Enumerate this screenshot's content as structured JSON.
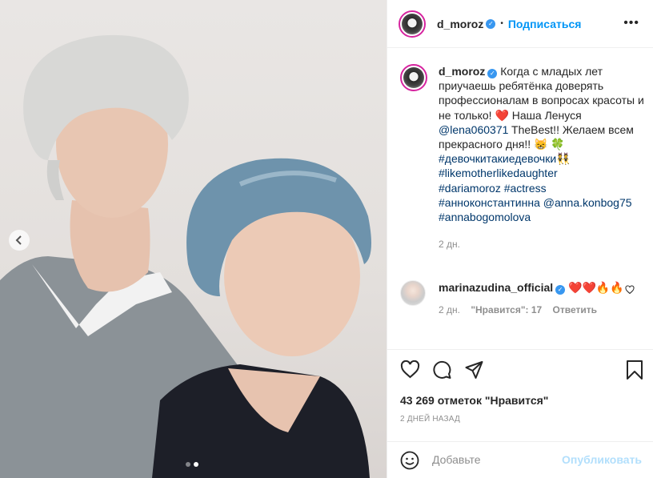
{
  "post": {
    "author": "d_moroz",
    "follow_label": "Подписаться",
    "header_dot": "•",
    "more_label": "•••"
  },
  "caption": {
    "username": "d_moroz",
    "text_1": "Когда с младых лет приучаешь ребятёнка доверять профессионалам в вопросах красоты и не только! ",
    "heart": "❤️",
    "text_2": " Наша Ленуся ",
    "mention_1": "@lena060371",
    "text_3": " TheBest!! Желаем всем прекрасного дня!! ",
    "emoji_1": "😸",
    "emoji_2": "🍀",
    "hashtag_1": "#девочкитакиедевочки",
    "emoji_3": "👯",
    "hashtag_2": "#likemotherlikedaughter",
    "hashtag_3": "#dariamoroz",
    "hashtag_4": "#actress",
    "hashtag_5": "#анноконстантинна",
    "mention_2": "@anna.konbog75",
    "hashtag_6": "#annabogomolova",
    "age": "2 дн."
  },
  "comment": {
    "username": "marinazudina_official",
    "text": "❤️❤️🔥🔥",
    "age": "2 дн.",
    "likes": "\"Нравится\": 17",
    "reply": "Ответить"
  },
  "likes_text": "43 269 отметок \"Нравится\"",
  "date_text": "2 ДНЕЙ НАЗАД",
  "add_comment": {
    "placeholder": "Добавьте",
    "post_label": "Опубликовать"
  },
  "colors": {
    "link_blue": "#00376b",
    "follow_blue": "#0095f6",
    "verified_blue": "#3897f0",
    "muted": "#8e8e8e",
    "post_disabled": "#b2dffc"
  },
  "icons": [
    "chevron-left-icon",
    "heart-icon",
    "comment-icon",
    "share-icon",
    "bookmark-icon",
    "emoji-icon",
    "verified-icon",
    "more-icon"
  ]
}
